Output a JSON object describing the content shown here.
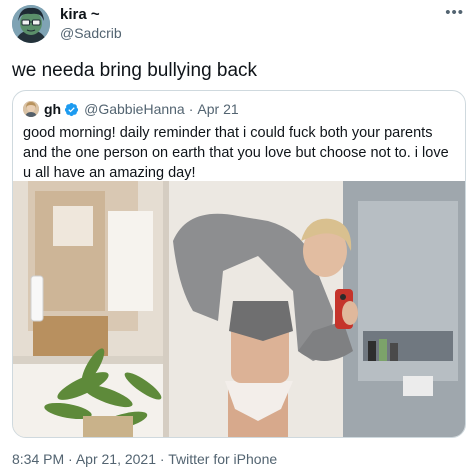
{
  "tweet": {
    "display_name": "kira ~",
    "handle": "@Sadcrib",
    "text": "we needa bring bullying back",
    "more_icon": "more-icon",
    "avatar_icon": "cartoon-avatar"
  },
  "quoted": {
    "display_name": "gh",
    "verified": true,
    "handle": "@GabbieHanna",
    "separator": "·",
    "date": "Apr 21",
    "text": "good morning! daily reminder that i could fuck both your parents and the one person on earth that you love but choose not to. i love u all have an amazing day!",
    "media_description": "mirror selfie photo"
  },
  "footer": {
    "time": "8:34 PM",
    "separator1": "·",
    "date": "Apr 21, 2021",
    "separator2": "·",
    "source": "Twitter for iPhone"
  },
  "colors": {
    "secondary_text": "#536471",
    "verified_blue": "#1d9bf0",
    "border": "#cfd9de"
  }
}
